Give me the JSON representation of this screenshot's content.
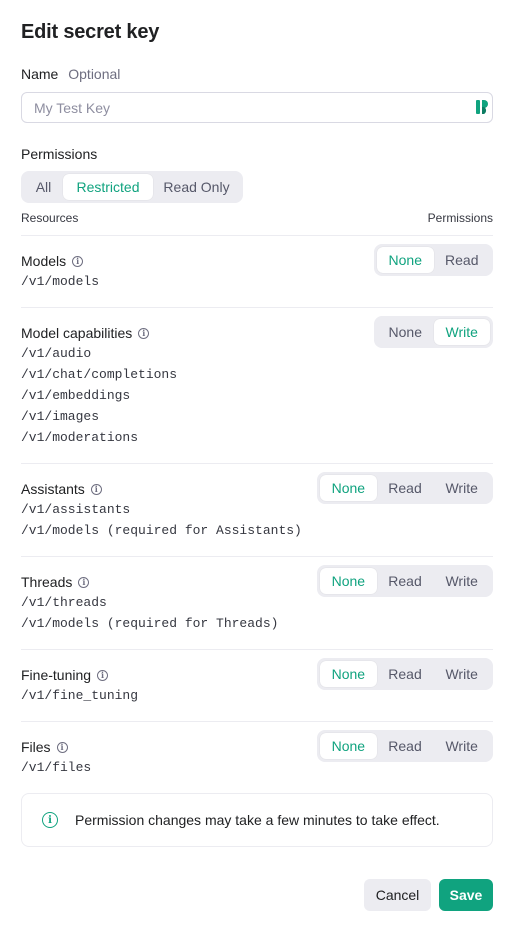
{
  "dialog": {
    "title": "Edit secret key",
    "name_label": "Name",
    "name_optional": "Optional",
    "name_placeholder": "My Test Key",
    "permissions_title": "Permissions",
    "permission_modes": [
      "All",
      "Restricted",
      "Read Only"
    ],
    "permission_mode_selected": "Restricted",
    "col_resources": "Resources",
    "col_permissions": "Permissions",
    "resources": [
      {
        "name": "Models",
        "endpoints": [
          "/v1/models"
        ],
        "options": [
          "None",
          "Read"
        ],
        "selected": "None"
      },
      {
        "name": "Model capabilities",
        "endpoints": [
          "/v1/audio",
          "/v1/chat/completions",
          "/v1/embeddings",
          "/v1/images",
          "/v1/moderations"
        ],
        "options": [
          "None",
          "Write"
        ],
        "selected": "Write"
      },
      {
        "name": "Assistants",
        "endpoints": [
          "/v1/assistants",
          "/v1/models (required for Assistants)"
        ],
        "options": [
          "None",
          "Read",
          "Write"
        ],
        "selected": "None"
      },
      {
        "name": "Threads",
        "endpoints": [
          "/v1/threads",
          "/v1/models (required for Threads)"
        ],
        "options": [
          "None",
          "Read",
          "Write"
        ],
        "selected": "None"
      },
      {
        "name": "Fine-tuning",
        "endpoints": [
          "/v1/fine_tuning"
        ],
        "options": [
          "None",
          "Read",
          "Write"
        ],
        "selected": "None"
      },
      {
        "name": "Files",
        "endpoints": [
          "/v1/files"
        ],
        "options": [
          "None",
          "Read",
          "Write"
        ],
        "selected": "None"
      }
    ],
    "notice": "Permission changes may take a few minutes to take effect.",
    "cancel_label": "Cancel",
    "save_label": "Save"
  },
  "colors": {
    "accent": "#10a37f",
    "segment_bg": "#ececf1",
    "border": "#d9d9e3"
  },
  "icons": {
    "info": "info-icon",
    "input_extension": "password-manager-icon"
  }
}
